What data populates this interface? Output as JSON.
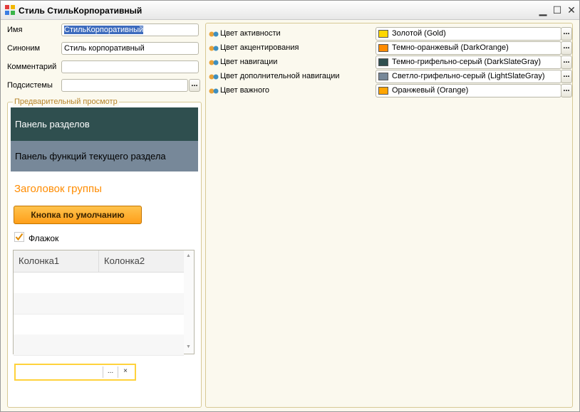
{
  "window": {
    "title": "Стиль СтильКорпоративный",
    "minimize": "▁",
    "maximize": "☐",
    "close": "✕"
  },
  "fields": {
    "name_label": "Имя",
    "name_value": "СтильКорпоративный",
    "synonym_label": "Синоним",
    "synonym_value": "Стиль корпоративный",
    "comment_label": "Комментарий",
    "comment_value": "",
    "subsystems_label": "Подсистемы",
    "subsystems_value": "",
    "dots": "..."
  },
  "preview": {
    "legend": "Предварительный просмотр",
    "sections_panel": "Панель разделов",
    "functions_panel": "Панель функций текущего раздела",
    "group_title": "Заголовок группы",
    "default_button": "Кнопка по умолчанию",
    "checkbox_label": "Флажок",
    "checkbox_checked": true,
    "columns": [
      "Колонка1",
      "Колонка2"
    ],
    "input_select": "...",
    "input_clear": "×"
  },
  "colors": [
    {
      "label": "Цвет активности",
      "value": "Золотой (Gold)",
      "hex": "#ffd700"
    },
    {
      "label": "Цвет акцентирования",
      "value": "Темно-оранжевый (DarkOrange)",
      "hex": "#ff8c00"
    },
    {
      "label": "Цвет навигации",
      "value": "Темно-грифельно-серый (DarkSlateGray)",
      "hex": "#2f4f4f"
    },
    {
      "label": "Цвет дополнительной навигации",
      "value": "Светло-грифельно-серый (LightSlateGray)",
      "hex": "#778899"
    },
    {
      "label": "Цвет важного",
      "value": "Оранжевый (Orange)",
      "hex": "#ffa500"
    }
  ]
}
